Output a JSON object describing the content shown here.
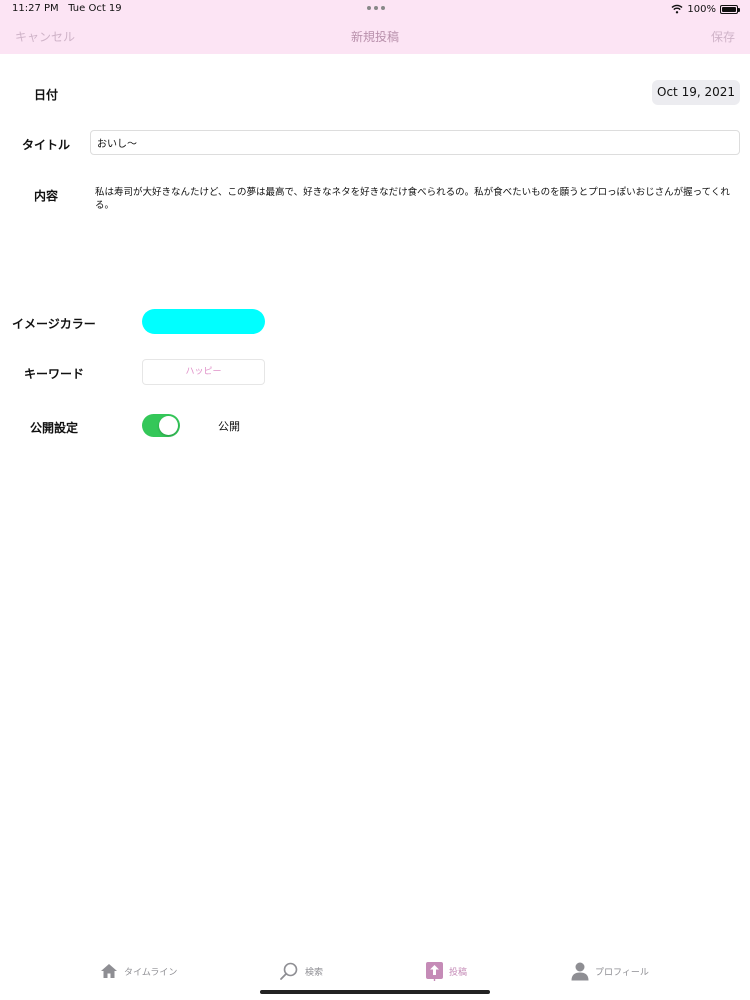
{
  "status_bar": {
    "time": "11:27 PM",
    "date": "Tue Oct 19",
    "battery": "100%",
    "battery_level": 1.0
  },
  "nav": {
    "cancel_label": "キャンセル",
    "title": "新規投稿",
    "save_label": "保存"
  },
  "form": {
    "date_label": "日付",
    "date_value": "Oct 19, 2021",
    "title_label": "タイトル",
    "title_value": "おいし〜",
    "content_label": "内容",
    "content_value": "私は寿司が大好きなんたけど、この夢は最高で、好きなネタを好きなだけ食べられるの。私が食べたいものを願うとプロっぽいおじさんが握ってくれる。",
    "image_color_label": "イメージカラー",
    "image_color_value": "#00FFFF",
    "keyword_label": "キーワード",
    "keyword_value": "ハッピー",
    "visibility_label": "公開設定",
    "visibility_on": true,
    "visibility_value": "公開"
  },
  "tabs": [
    {
      "label": "タイムライン",
      "icon": "home-icon",
      "active": false
    },
    {
      "label": "検索",
      "icon": "search-icon",
      "active": false
    },
    {
      "label": "投稿",
      "icon": "upload-icon",
      "active": true
    },
    {
      "label": "プロフィール",
      "icon": "person-icon",
      "active": false
    }
  ],
  "colors": {
    "nav_background": "#FCE4F4",
    "accent": "#C58BB7",
    "toggle_on": "#34C759",
    "keyword_text": "#E090C8"
  }
}
